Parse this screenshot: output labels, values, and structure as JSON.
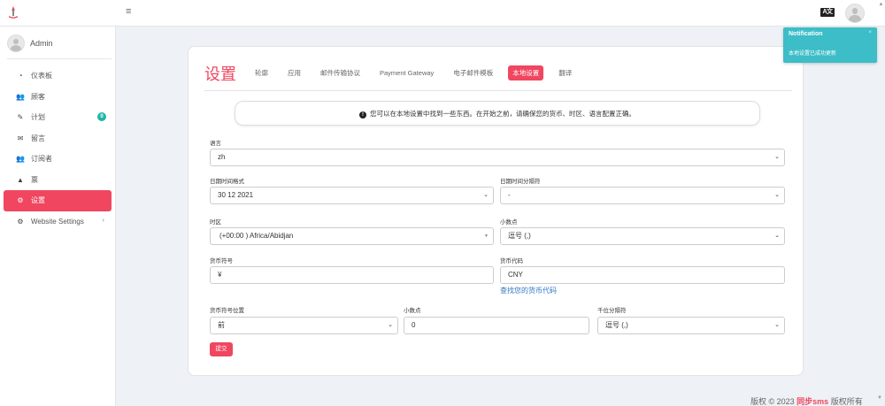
{
  "app": {
    "lang_icon": "A文",
    "user_name": "Admin"
  },
  "sidebar": {
    "items": [
      {
        "label": "仪表板",
        "icon": "dashboard-icon"
      },
      {
        "label": "顾客",
        "icon": "users-icon"
      },
      {
        "label": "计划",
        "icon": "plan-icon",
        "badge": "0"
      },
      {
        "label": "留言",
        "icon": "envelope-icon"
      },
      {
        "label": "订阅者",
        "icon": "subscribers-icon"
      },
      {
        "label": "票",
        "icon": "warning-icon"
      },
      {
        "label": "设置",
        "icon": "gear-icon",
        "active": true
      },
      {
        "label": "Website Settings",
        "icon": "cogs-icon",
        "has_submenu": true
      }
    ]
  },
  "settings": {
    "title": "设置",
    "tabs": [
      "轮廓",
      "应用",
      "邮件传输协议",
      "Payment Gateway",
      "电子邮件模板",
      "本地设置",
      "翻译"
    ],
    "active_tab": "本地设置",
    "alert": "您可以在本地设置中找到一些东西。在开始之前，请确保您的货币、时区、语言配置正确。"
  },
  "form": {
    "language_label": "语言",
    "language_value": "zh",
    "date_format_label": "日期时间格式",
    "date_format_value": "30 12 2021",
    "date_separator_label": "日期时间分隔符",
    "date_separator_value": "-",
    "timezone_label": "时区",
    "timezone_value": "(+00:00 ) Africa/Abidjan",
    "decimal_label": "小数点",
    "decimal_value": "逗号 (,)",
    "currency_symbol_label": "货币符号",
    "currency_symbol_value": "¥",
    "currency_code_label": "货币代码",
    "currency_code_value": "CNY",
    "find_currency_code_link": "查找您的货币代码",
    "currency_position_label": "货币符号位置",
    "currency_position_value": "前",
    "decimals_label": "小数点",
    "decimals_value": "0",
    "thousand_separator_label": "千位分隔符",
    "thousand_separator_value": "逗号 (,)",
    "submit_label": "提交"
  },
  "notification": {
    "title": "Notification",
    "close": "×",
    "message": "本地设置已成功更新"
  },
  "footer": {
    "copyright": "版权 © 2023",
    "brand": "同步sms",
    "rights": "版权所有"
  },
  "colors": {
    "accent": "#f0465f",
    "badge": "#1fb6a8",
    "toast": "#3cbdc7",
    "link": "#2f78c4"
  }
}
